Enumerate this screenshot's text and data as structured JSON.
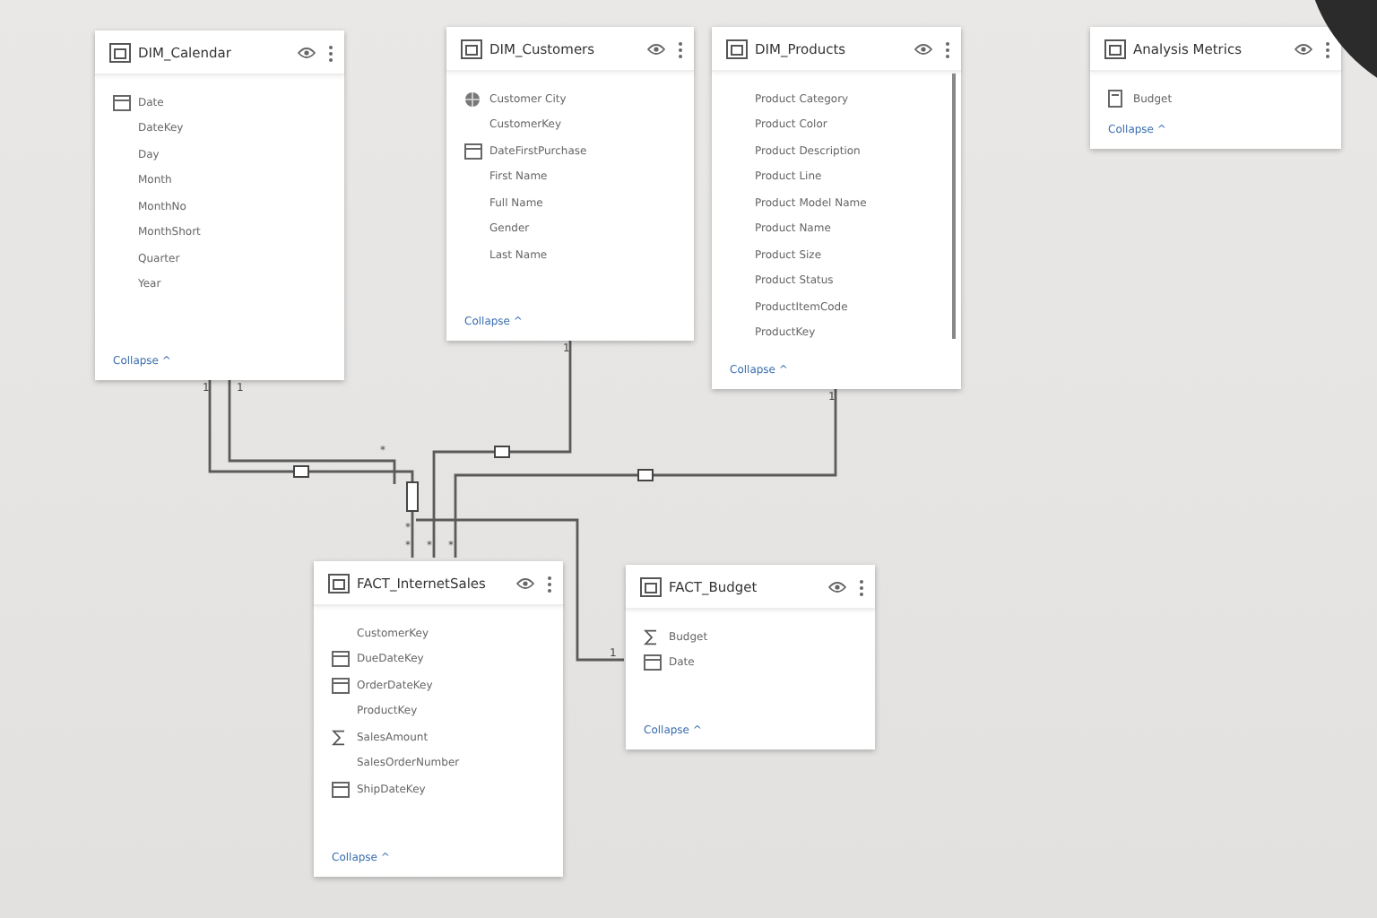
{
  "tables": [
    {
      "name": "DIM_Calendar",
      "fields": [
        {
          "name": "Date",
          "kind": "date"
        },
        {
          "name": "DateKey",
          "kind": "plain"
        },
        {
          "name": "Day",
          "kind": "plain"
        },
        {
          "name": "Month",
          "kind": "plain"
        },
        {
          "name": "MonthNo",
          "kind": "plain"
        },
        {
          "name": "MonthShort",
          "kind": "plain"
        },
        {
          "name": "Quarter",
          "kind": "plain"
        },
        {
          "name": "Year",
          "kind": "plain"
        }
      ],
      "collapse": "Collapse ^"
    },
    {
      "name": "DIM_Customers",
      "fields": [
        {
          "name": "Customer City",
          "kind": "geo"
        },
        {
          "name": "CustomerKey",
          "kind": "plain"
        },
        {
          "name": "DateFirstPurchase",
          "kind": "date"
        },
        {
          "name": "First Name",
          "kind": "plain"
        },
        {
          "name": "Full Name",
          "kind": "plain"
        },
        {
          "name": "Gender",
          "kind": "plain"
        },
        {
          "name": "Last Name",
          "kind": "plain"
        }
      ],
      "collapse": "Collapse ^"
    },
    {
      "name": "DIM_Products",
      "fields": [
        {
          "name": "Product Category",
          "kind": "plain"
        },
        {
          "name": "Product Color",
          "kind": "plain"
        },
        {
          "name": "Product Description",
          "kind": "plain"
        },
        {
          "name": "Product Line",
          "kind": "plain"
        },
        {
          "name": "Product Model Name",
          "kind": "plain"
        },
        {
          "name": "Product Name",
          "kind": "plain"
        },
        {
          "name": "Product Size",
          "kind": "plain"
        },
        {
          "name": "Product Status",
          "kind": "plain"
        },
        {
          "name": "ProductItemCode",
          "kind": "plain"
        },
        {
          "name": "ProductKey",
          "kind": "plain"
        }
      ],
      "collapse": "Collapse ^"
    },
    {
      "name": "Analysis Metrics",
      "fields": [
        {
          "name": "Budget",
          "kind": "measure"
        }
      ],
      "collapse": "Collapse ^"
    },
    {
      "name": "FACT_InternetSales",
      "fields": [
        {
          "name": "CustomerKey",
          "kind": "plain"
        },
        {
          "name": "DueDateKey",
          "kind": "date"
        },
        {
          "name": "OrderDateKey",
          "kind": "date"
        },
        {
          "name": "ProductKey",
          "kind": "plain"
        },
        {
          "name": "SalesAmount",
          "kind": "sum"
        },
        {
          "name": "SalesOrderNumber",
          "kind": "plain"
        },
        {
          "name": "ShipDateKey",
          "kind": "date"
        }
      ],
      "collapse": "Collapse ^"
    },
    {
      "name": "FACT_Budget",
      "fields": [
        {
          "name": "Budget",
          "kind": "sum"
        },
        {
          "name": "Date",
          "kind": "date"
        }
      ],
      "collapse": "Collapse ^"
    }
  ],
  "relationships": [
    {
      "one_label": "1",
      "many_label": "*"
    },
    {
      "one_label": "1",
      "many_label": "*"
    },
    {
      "one_label": "1",
      "many_label": "*"
    },
    {
      "one_label": "1",
      "many_label": "*"
    },
    {
      "one_label": "1",
      "many_label": "*"
    }
  ]
}
